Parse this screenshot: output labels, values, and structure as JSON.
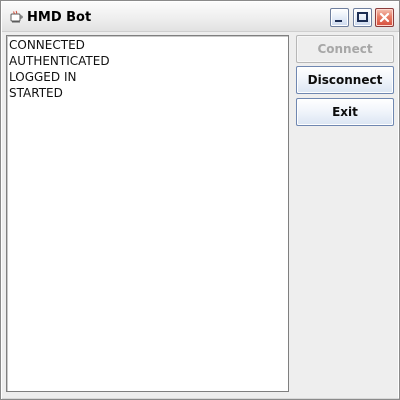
{
  "window": {
    "title": "HMD Bot",
    "title_bar_controls": [
      {
        "name": "minimize",
        "icon": "minimize-icon"
      },
      {
        "name": "maximize",
        "icon": "maximize-icon"
      },
      {
        "name": "close",
        "icon": "close-icon"
      }
    ],
    "app_icon": "java-icon"
  },
  "log": {
    "lines": [
      "CONNECTED",
      "AUTHENTICATED",
      "LOGGED IN",
      "STARTED"
    ]
  },
  "actions": {
    "connect": {
      "label": "Connect",
      "enabled": false
    },
    "disconnect": {
      "label": "Disconnect",
      "enabled": true
    },
    "exit": {
      "label": "Exit",
      "enabled": true
    }
  },
  "colors": {
    "window_background": "#eeeeee",
    "button_border": "#6f87b1",
    "disabled_text": "#a7a7a7",
    "close_button": "#d64f3d"
  }
}
